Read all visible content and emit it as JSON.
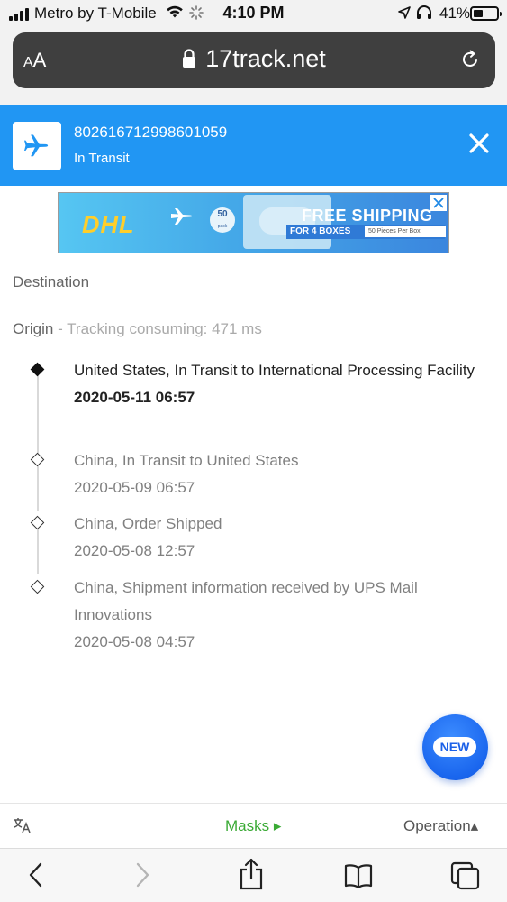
{
  "status_bar": {
    "carrier": "Metro by T-Mobile",
    "time": "4:10 PM",
    "battery": "41%",
    "battery_level": 0.41,
    "icons": [
      "signal-icon",
      "wifi-icon",
      "loading-spinner-icon",
      "location-arrow-icon",
      "headphones-icon",
      "battery-icon"
    ]
  },
  "browser": {
    "text_size_label_big": "A",
    "text_size_label_small": "A",
    "url": "17track.net",
    "icons": [
      "lock-icon",
      "reload-icon"
    ]
  },
  "tracking": {
    "number": "802616712998601059",
    "status": "In Transit",
    "carrier_icon": "airplane-icon",
    "close_icon": "close-icon",
    "header_color": "#2196f3"
  },
  "ad": {
    "logo": "DHL",
    "badge_number": "50",
    "badge_sub": "pack",
    "headline": "FREE SHIPPING",
    "subline": "FOR 4 BOXES",
    "small_text": "50 Pieces Per Box"
  },
  "labels": {
    "destination": "Destination",
    "origin": "Origin",
    "consuming": " - Tracking consuming: 471 ms"
  },
  "events": [
    {
      "description": "United States, In Transit to International Processing Facility",
      "time": "2020-05-11 06:57",
      "latest": true
    },
    {
      "description": "China, In Transit to United States",
      "time": "2020-05-09 06:57",
      "latest": false
    },
    {
      "description": "China, Order Shipped",
      "time": "2020-05-08 12:57",
      "latest": false
    },
    {
      "description": "China, Shipment information received by UPS Mail Innovations",
      "time": "2020-05-08 04:57",
      "latest": false
    }
  ],
  "fab": {
    "label": "NEW"
  },
  "site_bar": {
    "translate_icon": "translate-icon",
    "masks": "Masks ▸",
    "operation": "Operation▴"
  },
  "toolbar": {
    "icons": [
      "back-icon",
      "forward-icon",
      "share-icon",
      "bookmarks-icon",
      "tabs-icon"
    ]
  },
  "colors": {
    "accent_blue": "#2196f3",
    "masks_green": "#3aaa35",
    "fab_blue": "#1a66ee"
  }
}
